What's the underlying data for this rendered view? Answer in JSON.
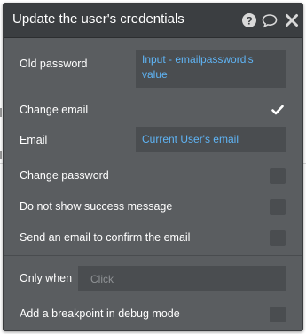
{
  "dialog": {
    "title": "Update the user's credentials",
    "header_icons": [
      "question-circle-icon",
      "comment-icon",
      "close-icon"
    ]
  },
  "fields": {
    "old_password": {
      "label": "Old password",
      "value": "Input - emailpassword's value"
    },
    "change_email": {
      "label": "Change email",
      "checked": true
    },
    "email": {
      "label": "Email",
      "value": "Current User's email"
    },
    "change_password": {
      "label": "Change password",
      "checked": false
    },
    "no_success_message": {
      "label": "Do not show success message",
      "checked": false
    },
    "send_confirm_email": {
      "label": "Send an email to confirm the email",
      "checked": false
    }
  },
  "condition": {
    "label": "Only when",
    "placeholder": "Click"
  },
  "breakpoint": {
    "label": "Add a breakpoint in debug mode",
    "checked": false
  },
  "colors": {
    "panel_bg": "#5a5d60",
    "header_bg": "#3b3e41",
    "field_bg": "#4a4d50",
    "dynamic_text": "#5fb4f5"
  }
}
